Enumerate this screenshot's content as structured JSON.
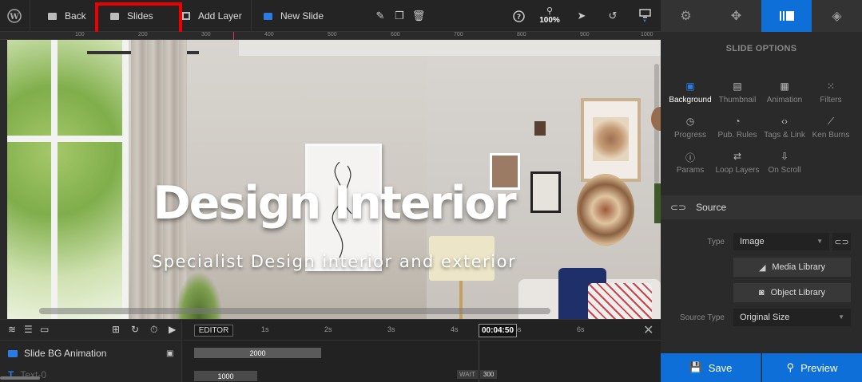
{
  "toolbar": {
    "back_label": "Back",
    "slides_label": "Slides",
    "add_layer_label": "Add Layer",
    "new_slide_label": "New Slide",
    "zoom": "100%"
  },
  "ruler": {
    "ticks": [
      "100",
      "200",
      "300",
      "400",
      "500",
      "600",
      "700",
      "800",
      "900",
      "1000"
    ]
  },
  "slide": {
    "title": "Design Interior",
    "subtitle": "Specialist Design interior and exterior"
  },
  "timeline": {
    "editor_label": "EDITOR",
    "seconds": [
      "1s",
      "2s",
      "3s",
      "4s",
      "5s",
      "6s"
    ],
    "timecode": "00:04:50",
    "rows": [
      {
        "label": "Slide BG Animation",
        "bar_value": "2000"
      },
      {
        "label": "Text-0",
        "bar_value": "1000"
      }
    ],
    "wait_label": "WAIT",
    "wait_value": "300"
  },
  "panel": {
    "title": "SLIDE OPTIONS",
    "options": [
      {
        "label": "Background",
        "icon": "image-icon"
      },
      {
        "label": "Thumbnail",
        "icon": "thumbnail-icon"
      },
      {
        "label": "Animation",
        "icon": "film-icon"
      },
      {
        "label": "Filters",
        "icon": "filters-icon"
      },
      {
        "label": "Progress",
        "icon": "timer-icon"
      },
      {
        "label": "Pub. Rules",
        "icon": "clock-icon"
      },
      {
        "label": "Tags & Link",
        "icon": "code-icon"
      },
      {
        "label": "Ken Burns",
        "icon": "kenburns-icon"
      },
      {
        "label": "Params",
        "icon": "info-icon"
      },
      {
        "label": "Loop Layers",
        "icon": "loop-icon"
      },
      {
        "label": "On Scroll",
        "icon": "scroll-icon"
      }
    ],
    "source_title": "Source",
    "type_label": "Type",
    "type_value": "Image",
    "media_library": "Media Library",
    "object_library": "Object Library",
    "source_type_label": "Source Type",
    "source_type_value": "Original Size",
    "save_label": "Save",
    "preview_label": "Preview",
    "accent_color": "#0f6fd8"
  }
}
